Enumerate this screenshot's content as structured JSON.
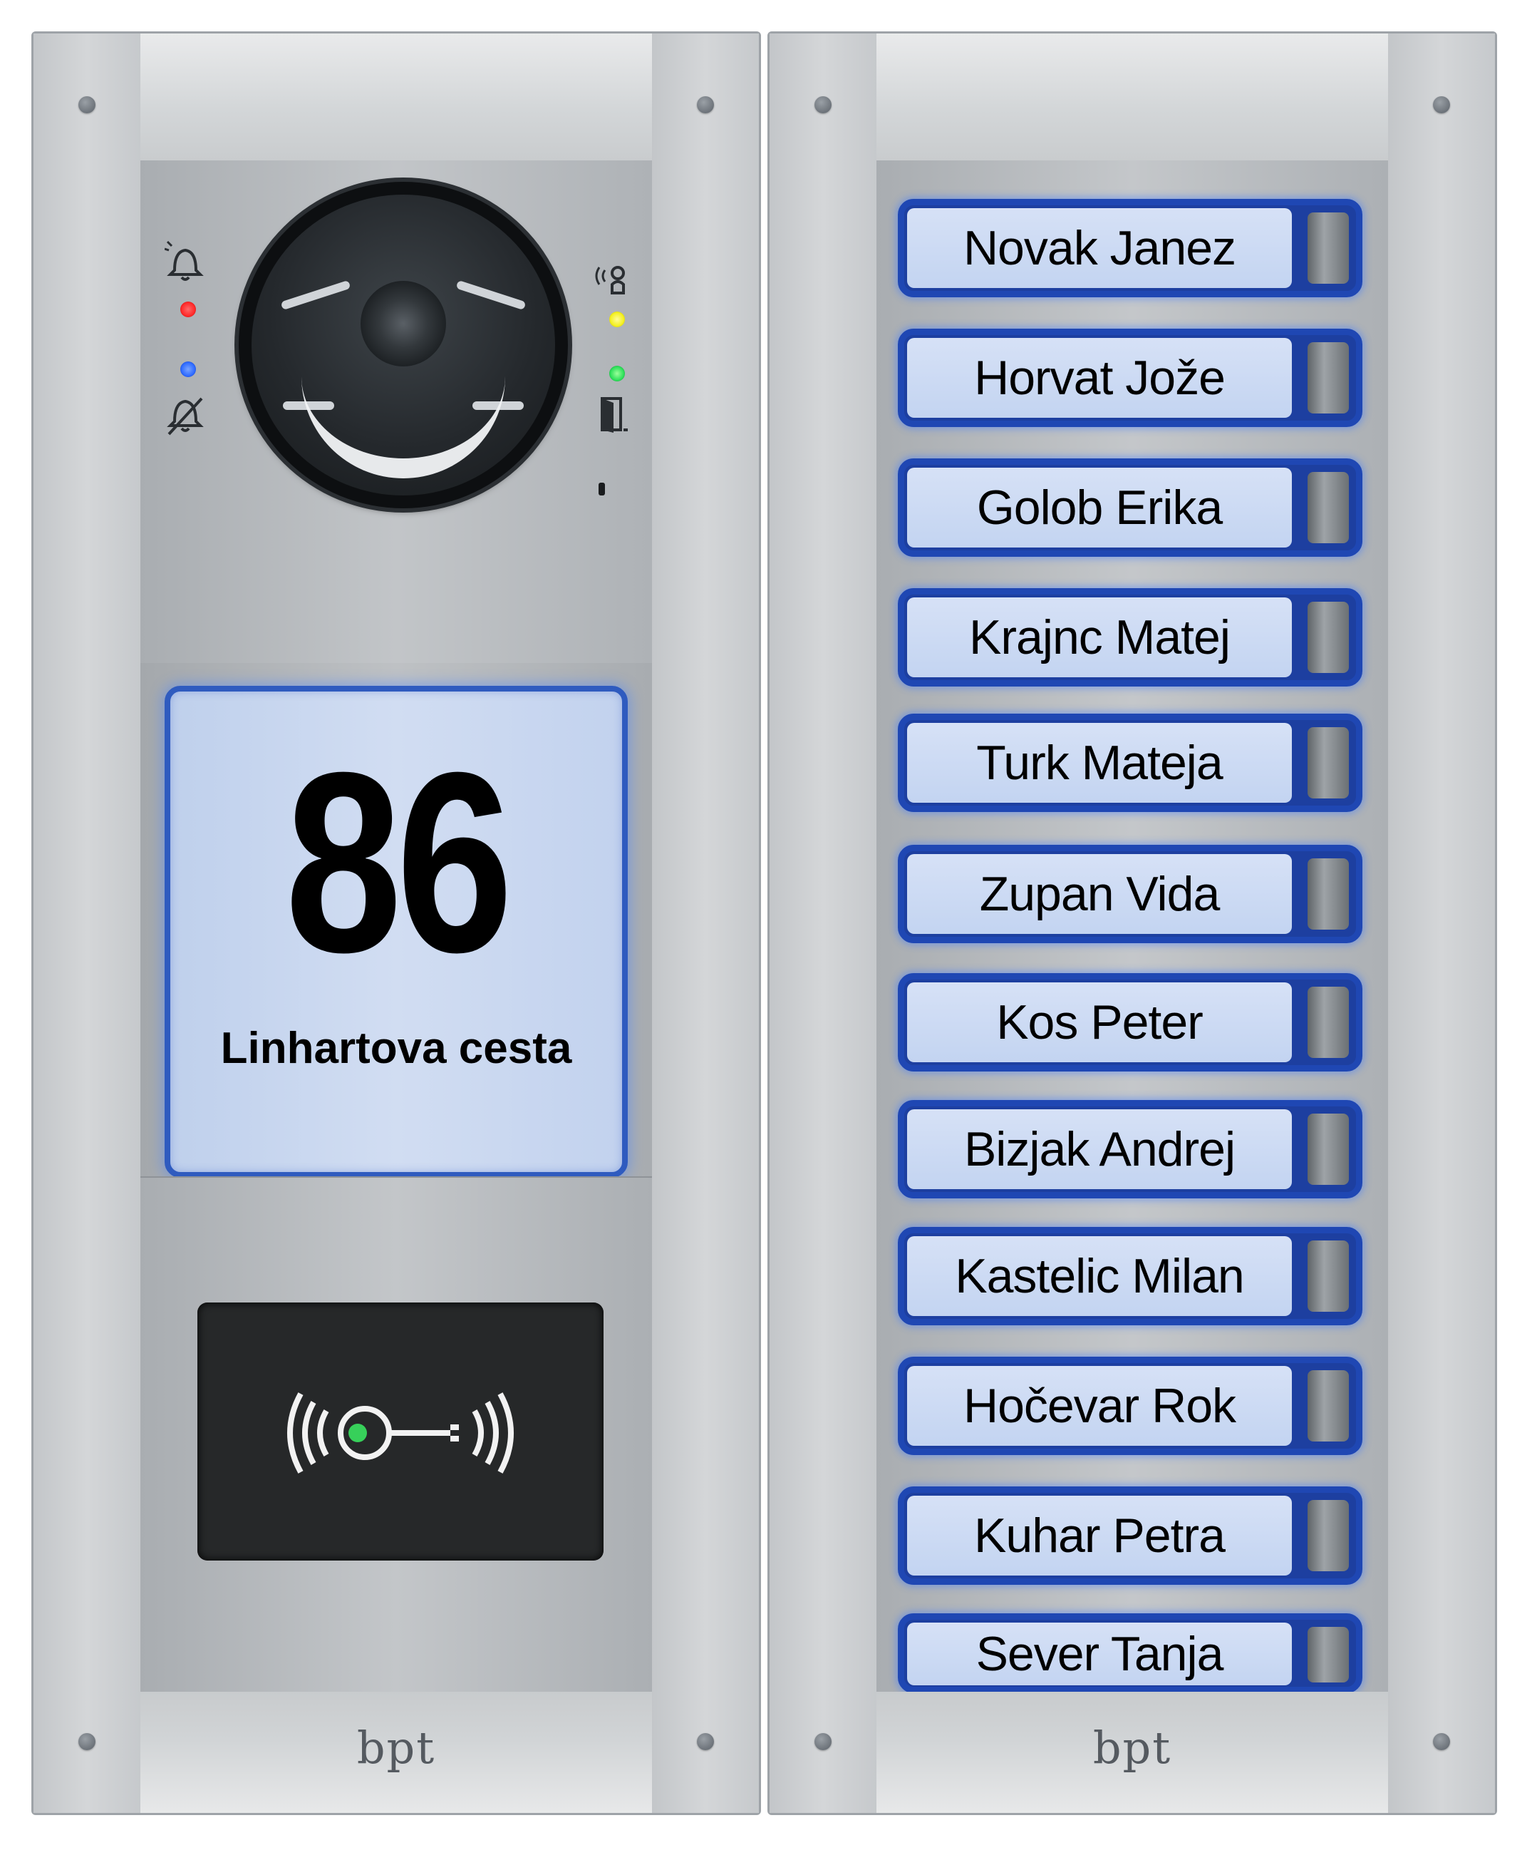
{
  "panel_left": {
    "house_number": "86",
    "street_name": "Linhartova cesta",
    "brand_logo": "bpt",
    "indicators": [
      {
        "icon": "bell-ringing-icon",
        "led_color": "#ff2a2a"
      },
      {
        "icon": "bell-muted-icon",
        "led_color": "#2f6bff"
      },
      {
        "icon": "speaking-icon",
        "led_color": "#f4f020"
      },
      {
        "icon": "door-open-icon",
        "led_color": "#2ee05a"
      }
    ],
    "rfid_reader": {
      "icon": "key-wireless-icon",
      "led_color": "#37d05a"
    }
  },
  "panel_right": {
    "brand_logo": "bpt",
    "residents": [
      {
        "name": "Novak Janez"
      },
      {
        "name": "Horvat Jože"
      },
      {
        "name": "Golob Erika"
      },
      {
        "name": "Krajnc Matej"
      },
      {
        "name": "Turk Mateja"
      },
      {
        "name": "Zupan Vida"
      },
      {
        "name": "Kos Peter"
      },
      {
        "name": "Bizjak Andrej"
      },
      {
        "name": "Kastelic Milan"
      },
      {
        "name": "Hočevar Rok"
      },
      {
        "name": "Kuhar Petra"
      },
      {
        "name": "Sever Tanja"
      }
    ]
  },
  "colors": {
    "button_border": "#1f47b3",
    "label_background": "#cbd9f3",
    "panel_metal": "#cfd2d5"
  }
}
